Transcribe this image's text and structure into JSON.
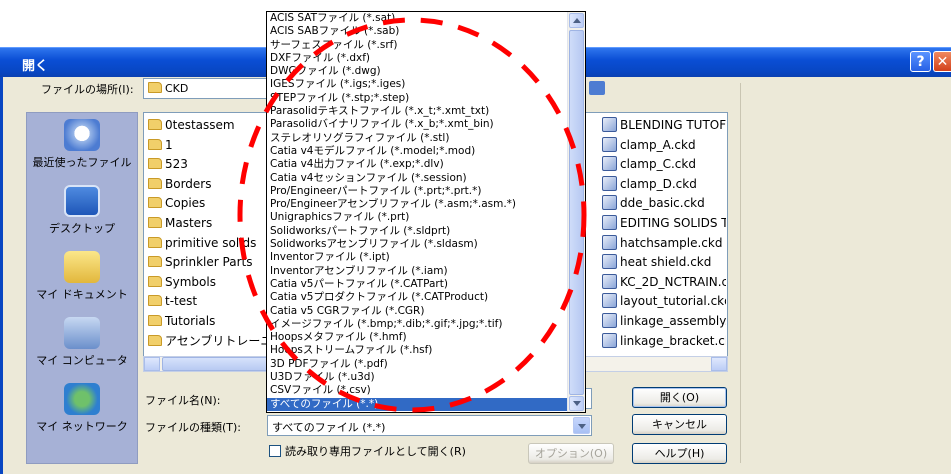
{
  "window": {
    "title": "開く"
  },
  "location": {
    "label": "ファイルの場所(I):",
    "value": "CKD"
  },
  "places": [
    {
      "label": "最近使ったファイル",
      "icon": "recent-icon"
    },
    {
      "label": "デスクトップ",
      "icon": "desktop-icon"
    },
    {
      "label": "マイ ドキュメント",
      "icon": "my-documents-icon"
    },
    {
      "label": "マイ コンピュータ",
      "icon": "my-computer-icon"
    },
    {
      "label": "マイ ネットワーク",
      "icon": "my-network-icon"
    }
  ],
  "folders": [
    "0testassem",
    "1",
    "523",
    "Borders",
    "Copies",
    "Masters",
    "primitive solids",
    "Sprinkler Parts",
    "Symbols",
    "t-test",
    "Tutorials",
    "アセンブリトレーニング"
  ],
  "files": [
    "BLENDING TUTOF",
    "clamp_A.ckd",
    "clamp_C.ckd",
    "clamp_D.ckd",
    "dde_basic.ckd",
    "EDITING SOLIDS T",
    "hatchsample.ckd",
    "heat shield.ckd",
    "KC_2D_NCTRAIN.c",
    "layout_tutorial.ckd",
    "linkage_assembly.c",
    "linkage_bracket.ckd"
  ],
  "filename": {
    "label": "ファイル名(N):",
    "value": ""
  },
  "filetype": {
    "label": "ファイルの種類(T):",
    "value": "すべてのファイル (*.*)"
  },
  "readonly": {
    "label": "読み取り専用ファイルとして開く(R)"
  },
  "buttons": {
    "open": "開く(O)",
    "cancel": "キャンセル",
    "options": "オプション(O)",
    "help": "ヘルプ(H)"
  },
  "dropdown_items": [
    "ACIS SATファイル (*.sat)",
    "ACIS SABファイル (*.sab)",
    "サーフェスファイル (*.srf)",
    "DXFファイル (*.dxf)",
    "DWGファイル (*.dwg)",
    "IGESファイル (*.igs;*.iges)",
    "STEPファイル (*.stp;*.step)",
    "Parasolidテキストファイル (*.x_t;*.xmt_txt)",
    "Parasolidバイナリファイル (*.x_b;*.xmt_bin)",
    "ステレオリソグラフィファイル (*.stl)",
    "Catia v4モデルファイル (*.model;*.mod)",
    "Catia v4出力ファイル (*.exp;*.dlv)",
    "Catia v4セッションファイル (*.session)",
    "Pro/Engineerパートファイル (*.prt;*.prt.*)",
    "Pro/Engineerアセンブリファイル (*.asm;*.asm.*)",
    "Unigraphicsファイル (*.prt)",
    "Solidworksパートファイル (*.sldprt)",
    "Solidworksアセンブリファイル (*.sldasm)",
    "Inventorファイル (*.ipt)",
    "Inventorアセンブリファイル (*.iam)",
    "Catia v5パートファイル (*.CATPart)",
    "Catia v5プロダクトファイル (*.CATProduct)",
    "Catia v5 CGRファイル (*.CGR)",
    "イメージファイル (*.bmp;*.dib;*.gif;*.jpg;*.tif)",
    "Hoopsメタファイル (*.hmf)",
    "Hoopsストリームファイル (*.hsf)",
    "3D PDFファイル (*.pdf)",
    "U3Dファイル (*.u3d)",
    "CSVファイル (*.csv)",
    "すべてのファイル (*.*)"
  ],
  "selected_filetype_index": 29,
  "colors": {
    "titlebar": "#0a4ed5",
    "selection": "#316ac5",
    "annotation": "#ff0000"
  }
}
